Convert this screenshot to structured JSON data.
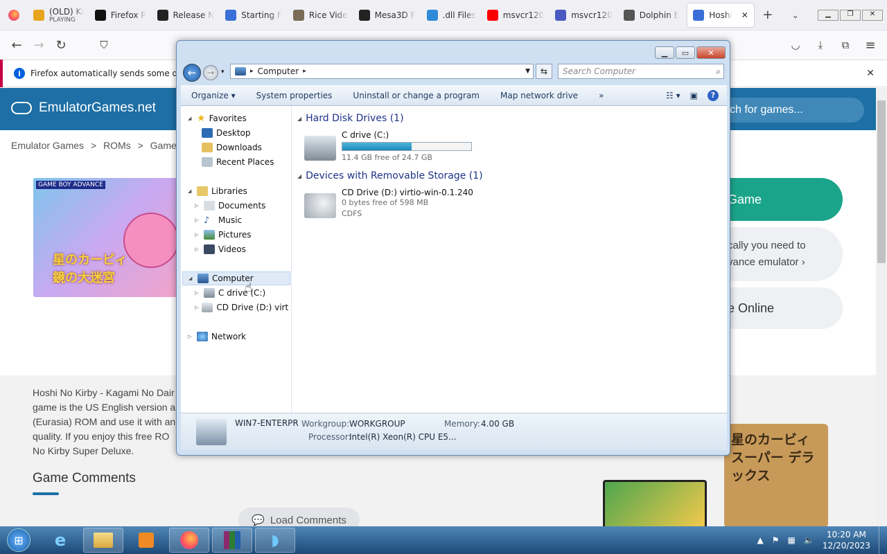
{
  "browser": {
    "tabs": [
      {
        "label": "(OLD) Ki",
        "sub": "PLAYING",
        "icon": "coin-icon",
        "color": "#e8a51f"
      },
      {
        "label": "Firefox P",
        "icon": "mdn-icon",
        "color": "#111111"
      },
      {
        "label": "Release N",
        "icon": "github-icon",
        "color": "#222222"
      },
      {
        "label": "Starting F",
        "icon": "gitbook-icon",
        "color": "#3a6fd8"
      },
      {
        "label": "Rice Vide",
        "icon": "rice-icon",
        "color": "#7a6c55"
      },
      {
        "label": "Mesa3D F",
        "icon": "mesa-icon",
        "color": "#222222"
      },
      {
        "label": ".dll Files",
        "icon": "dll-icon",
        "color": "#2f8ad8"
      },
      {
        "label": "msvcr120",
        "icon": "youtube-icon",
        "color": "#ff0000"
      },
      {
        "label": "msvcr120",
        "icon": "sts-icon",
        "color": "#4b5ac2"
      },
      {
        "label": "Dolphin E",
        "icon": "dolphin-icon",
        "color": "#555555"
      },
      {
        "label": "Hoshi",
        "icon": "gitbook-icon",
        "color": "#3a6fd8",
        "active": true
      }
    ],
    "notification": "Firefox automatically sends some data to"
  },
  "site": {
    "logo": "EmulatorGames.net",
    "search_placeholder": "ch for games...",
    "breadcrumb": [
      "Emulator Games",
      ">",
      "ROMs",
      ">",
      "Gamebo"
    ],
    "cover": {
      "badge": "GAME BOY ADVANCE",
      "title": "星のカービィ 鏡の大迷宮"
    },
    "btn_game": "Game",
    "btn_emu_line1": "cally you need to",
    "btn_emu_line2": "vance emulator ›",
    "btn_online": "e Online",
    "description": [
      "Hoshi No Kirby - Kagami No Dair",
      "game is the US English version a",
      "(Eurasia) ROM and use it with an",
      "quality. If you enjoy this free RO",
      "No Kirby Super Deluxe."
    ],
    "comments_heading": "Game Comments",
    "load_comments": "Load Comments",
    "thumb2_text": "星のカービィ スーパー デラックス"
  },
  "explorer": {
    "address": "Computer",
    "search_placeholder": "Search Computer",
    "commands": [
      "Organize ▾",
      "System properties",
      "Uninstall or change a program",
      "Map network drive",
      "»"
    ],
    "nav": {
      "favorites": "Favorites",
      "desktop": "Desktop",
      "downloads": "Downloads",
      "recent": "Recent Places",
      "libraries": "Libraries",
      "documents": "Documents",
      "music": "Music",
      "pictures": "Pictures",
      "videos": "Videos",
      "computer": "Computer",
      "c_drive": "C drive (C:)",
      "cd_drive": "CD Drive (D:) virtio-win",
      "network": "Network"
    },
    "groups": {
      "hdd": "Hard Disk Drives (1)",
      "removable": "Devices with Removable Storage (1)"
    },
    "drives": {
      "c": {
        "name": "C drive (C:)",
        "free": "11.4 GB free of 24.7 GB",
        "used_fraction": 0.54
      },
      "d": {
        "name": "CD Drive (D:) virtio-win-0.1.240",
        "free": "0 bytes free of 598 MB",
        "fs": "CDFS"
      }
    },
    "details": {
      "name": "WIN7-ENTERPR",
      "workgroup_label": "Workgroup:",
      "workgroup": "WORKGROUP",
      "memory_label": "Memory:",
      "memory": "4.00 GB",
      "processor_label": "Processor:",
      "processor": "Intel(R) Xeon(R) CPU E5..."
    }
  },
  "taskbar": {
    "time": "10:20 AM",
    "date": "12/20/2023"
  }
}
